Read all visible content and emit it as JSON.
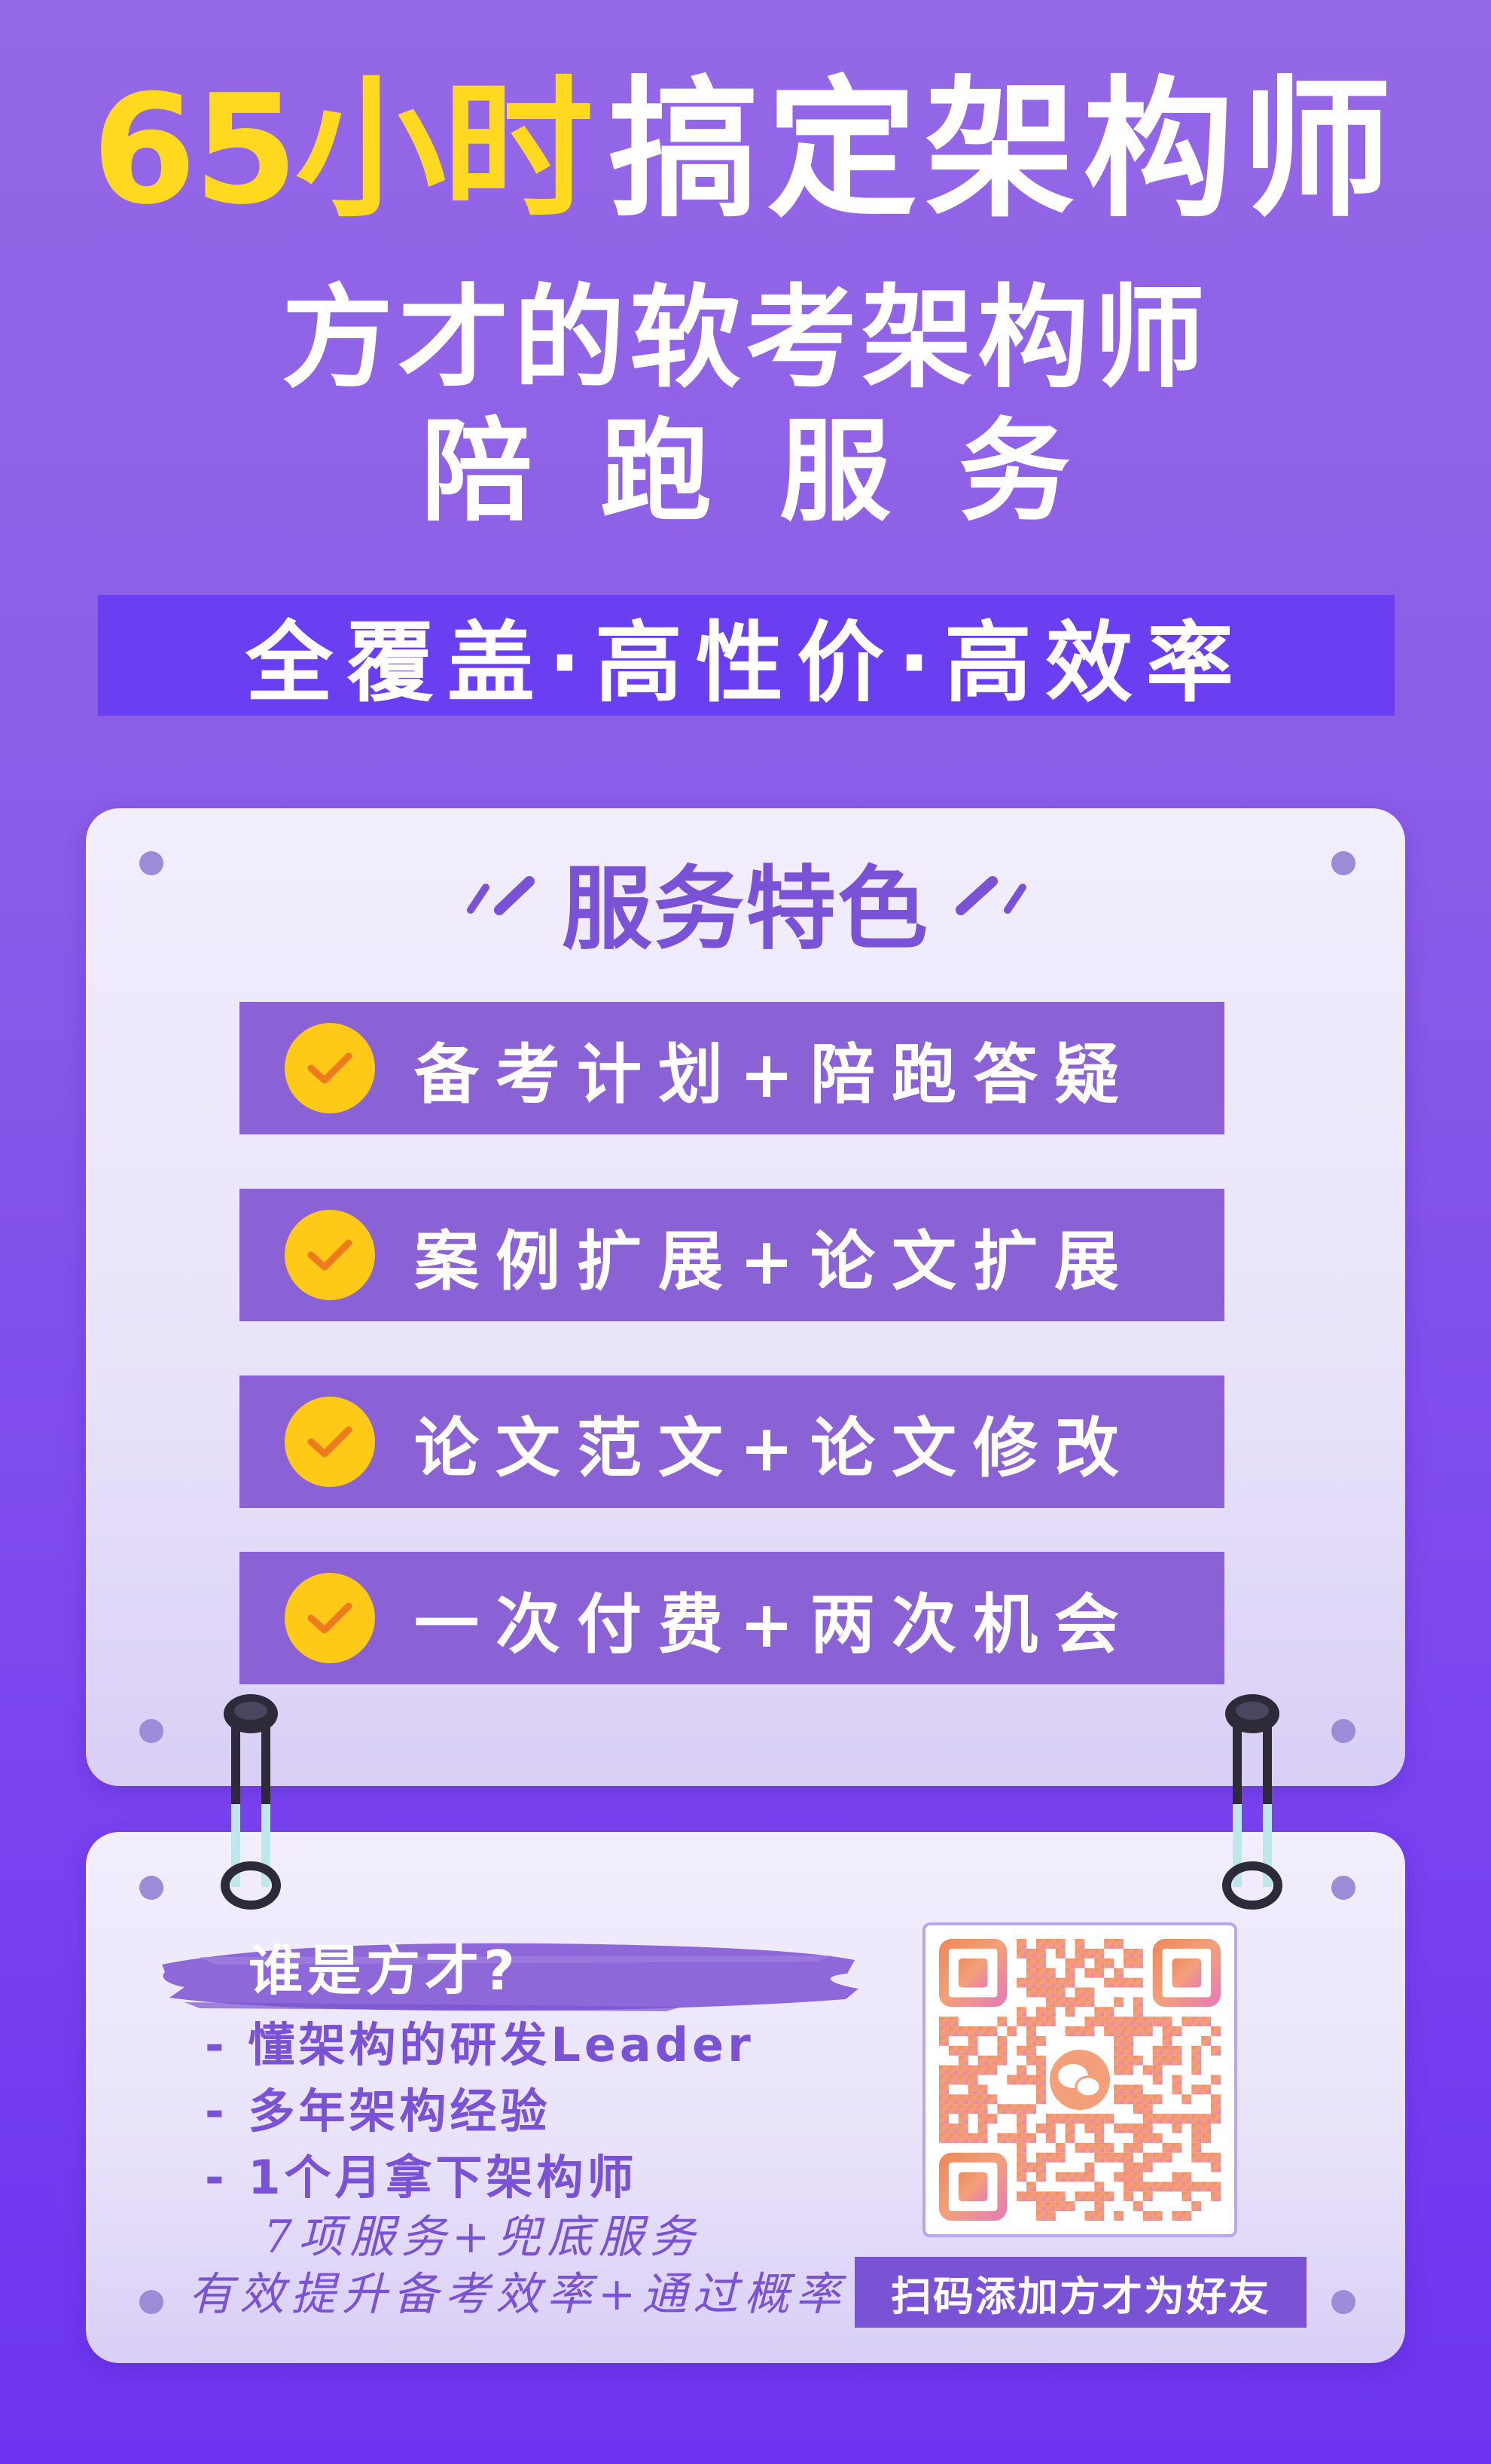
{
  "headline": {
    "highlight": "65小时",
    "main": "搞定架构师"
  },
  "subtitle_1": "方才的软考架构师",
  "subtitle_2": "陪跑服务",
  "banner": "全覆盖·高性价·高效率",
  "features_title": "服务特色",
  "features": [
    {
      "label": "备考计划+陪跑答疑"
    },
    {
      "label": "案例扩展+论文扩展"
    },
    {
      "label": "论文范文+论文修改"
    },
    {
      "label": "一次付费+两次机会"
    }
  ],
  "about": {
    "title": "谁是方才?",
    "bullets": [
      "- 懂架构的研发Leader",
      "- 多年架构经验",
      "- 1个月拿下架构师"
    ],
    "note_1": "7项服务+兜底服务",
    "note_2": "有效提升备考效率+通过概率"
  },
  "qr": {
    "button": "扫码添加方才为好友",
    "icon": "wechat-icon"
  },
  "colors": {
    "background_top": "#9468e6",
    "background_bottom": "#6c34f0",
    "headline_accent": "#ffd91f",
    "banner": "#6a3ff2",
    "feature_bar": "#8a62d6",
    "check_circle": "#ffc917",
    "check_mark": "#f07b1e",
    "purple_text": "#7a52d6"
  }
}
